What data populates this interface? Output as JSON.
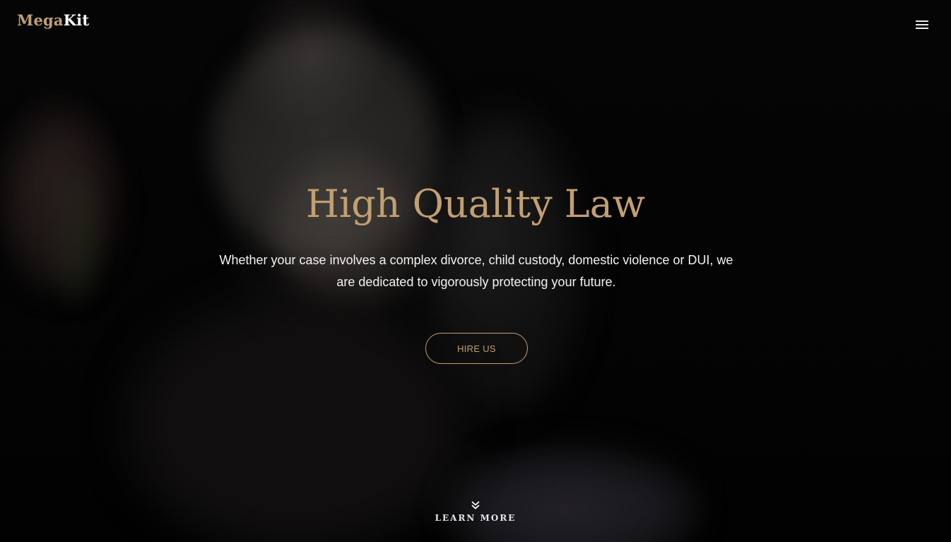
{
  "header": {
    "logo_part1": "Mega",
    "logo_part2": "Kit",
    "menu_icon": "hamburger-menu-icon"
  },
  "hero": {
    "title": "High Quality Law",
    "description": "Whether your case involves a complex divorce, child custody, domestic violence or DUI, we are dedicated to vigorously protecting your future.",
    "cta_label": "HIRE US",
    "learn_more_label": "LEARN MORE",
    "learn_more_icon": "double-chevron-down-icon"
  },
  "colors": {
    "accent": "#c29f72",
    "text": "#f2f2f2",
    "background": "#050505"
  }
}
